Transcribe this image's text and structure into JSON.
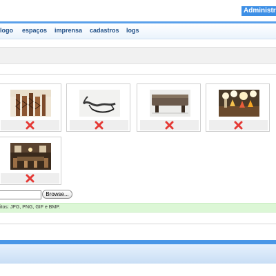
{
  "header": {
    "admin_button_label": "Administração"
  },
  "nav": {
    "items": [
      {
        "label": "logo"
      },
      {
        "label": "espaços"
      },
      {
        "label": "imprensa"
      },
      {
        "label": "cadastros"
      },
      {
        "label": "logs"
      }
    ]
  },
  "gallery": {
    "images": [
      {
        "name": "brown-block-sculptures-photo"
      },
      {
        "name": "chaise-lounge-photo"
      },
      {
        "name": "stone-bench-photo"
      },
      {
        "name": "table-lamps-photo"
      },
      {
        "name": "dining-room-photo"
      }
    ],
    "delete_icon": "red-x-delete-icon",
    "delete_color": "#e53935"
  },
  "upload": {
    "browse_label": "Browse...",
    "formats_text": "itos: JPG, PNG, GIF e BMP."
  },
  "colors": {
    "accent": "#3d8fe6",
    "nav_text": "#1f4e86",
    "info_bg": "#dcf7d6"
  }
}
